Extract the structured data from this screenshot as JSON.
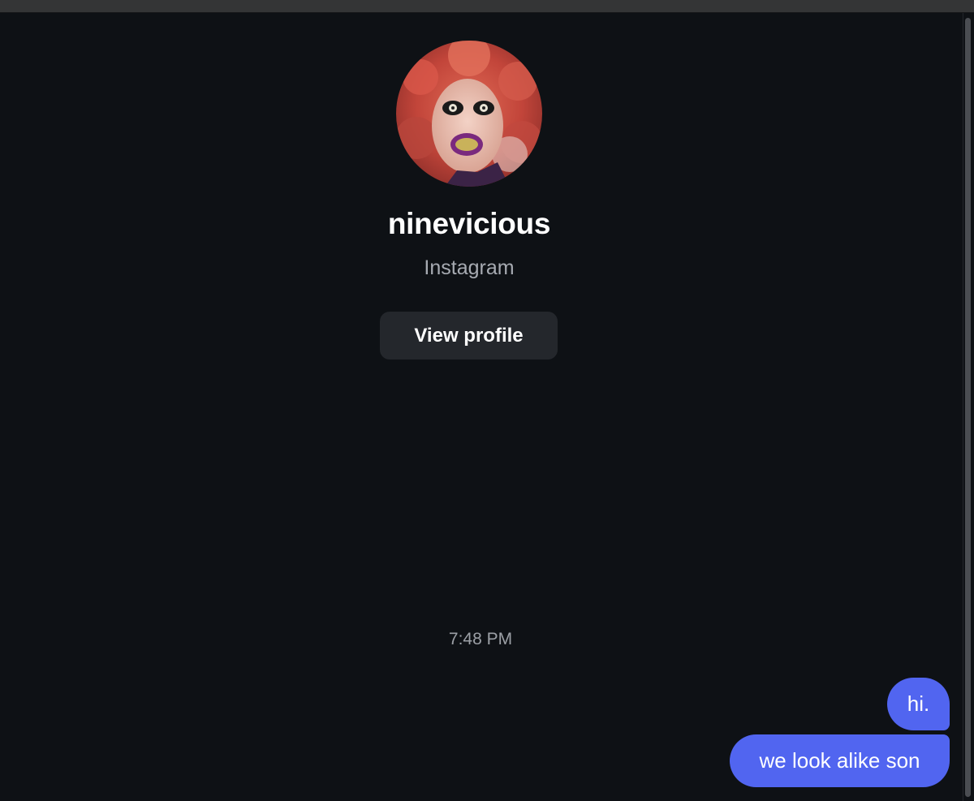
{
  "profile": {
    "username": "ninevicious",
    "platform": "Instagram",
    "view_profile_label": "View profile",
    "avatar_icon": "profile-photo"
  },
  "conversation": {
    "timestamp": "7:48 PM",
    "messages": [
      {
        "text": "hi.",
        "sender": "self"
      },
      {
        "text": "we look alike son",
        "sender": "self"
      }
    ]
  },
  "colors": {
    "background": "#0e1115",
    "bubble": "#5165f0",
    "button": "#24272c",
    "secondary_text": "#a7abb2"
  }
}
